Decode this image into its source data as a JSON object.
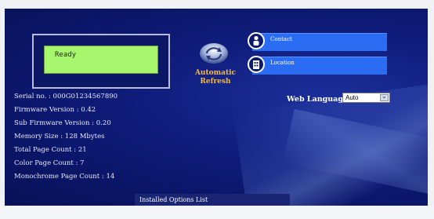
{
  "lcd": {
    "text": "Ready"
  },
  "refresh": {
    "line1": "Automatic",
    "line2": "Refresh"
  },
  "links": [
    {
      "label": "Contact"
    },
    {
      "label": "Location"
    }
  ],
  "info": {
    "serial": "Serial no. : 000G01234567890",
    "firmware": "Firmware Version : 0.42",
    "sub_firmware": "Sub Firmware Version : 0.20",
    "memory": "Memory Size : 128 Mbytes",
    "total_pages": "Total Page Count : 21",
    "color_pages": "Color Page Count : 7",
    "mono_pages": "Monochrome Page Count : 14"
  },
  "language": {
    "label": "Web Language:",
    "value": "Auto"
  },
  "options": {
    "label": "Installed Options List"
  },
  "colors": {
    "panel": "#0f1d7c",
    "lcd": "#a8f56e",
    "link_bar": "#2a6cf2",
    "accent": "#f5b942"
  }
}
